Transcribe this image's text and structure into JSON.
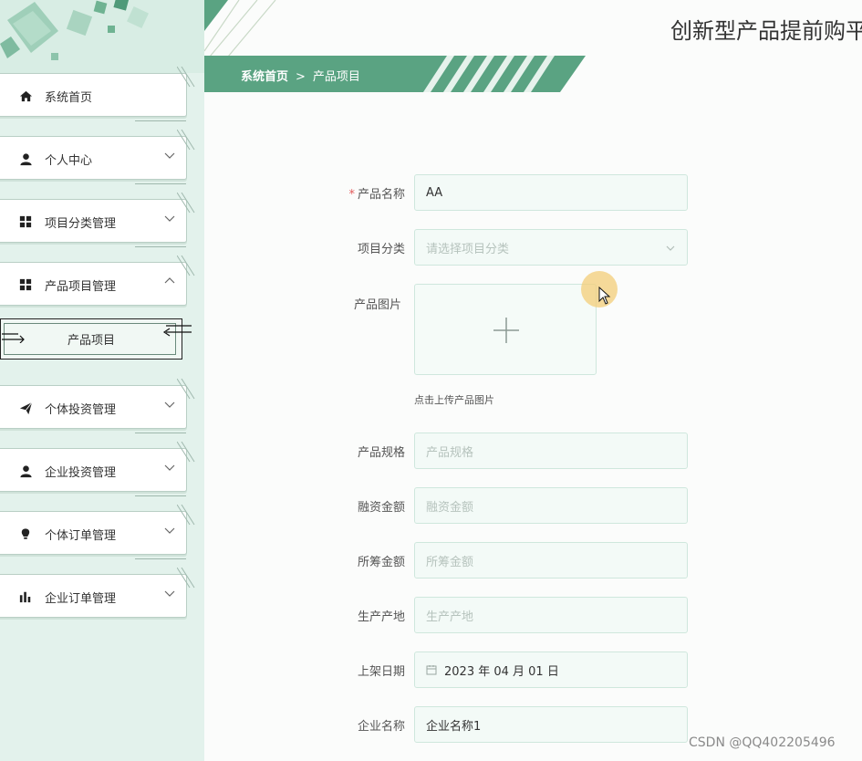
{
  "app": {
    "title": "创新型产品提前购平"
  },
  "breadcrumb": {
    "home": "系统首页",
    "separator": ">",
    "current": "产品项目"
  },
  "sidebar": {
    "items": [
      {
        "label": "系统首页",
        "icon": "home-icon"
      },
      {
        "label": "个人中心",
        "icon": "user-icon"
      },
      {
        "label": "项目分类管理",
        "icon": "grid-icon"
      },
      {
        "label": "产品项目管理",
        "icon": "grid-icon",
        "expanded": true
      },
      {
        "label": "个体投资管理",
        "icon": "paper-plane-icon"
      },
      {
        "label": "企业投资管理",
        "icon": "user-icon"
      },
      {
        "label": "个体订单管理",
        "icon": "bulb-icon"
      },
      {
        "label": "企业订单管理",
        "icon": "bar-chart-icon"
      }
    ],
    "submenu": {
      "label": "产品项目"
    }
  },
  "form": {
    "name": {
      "label": "产品名称",
      "required": "*",
      "value": "AA"
    },
    "category": {
      "label": "项目分类",
      "placeholder": "请选择项目分类"
    },
    "image": {
      "label": "产品图片",
      "hint": "点击上传产品图片"
    },
    "spec": {
      "label": "产品规格",
      "placeholder": "产品规格"
    },
    "financing": {
      "label": "融资金额",
      "placeholder": "融资金额"
    },
    "raised": {
      "label": "所筹金额",
      "placeholder": "所筹金额"
    },
    "origin": {
      "label": "生产产地",
      "placeholder": "生产产地"
    },
    "date": {
      "label": "上架日期",
      "value": "2023 年 04 月 01 日"
    },
    "company": {
      "label": "企业名称",
      "value": "企业名称1"
    }
  },
  "watermark": "CSDN @QQ402205496",
  "colors": {
    "accent": "#5aa382",
    "sidebar_bg": "#e3f2ec",
    "field_border": "#cfe7dd"
  }
}
